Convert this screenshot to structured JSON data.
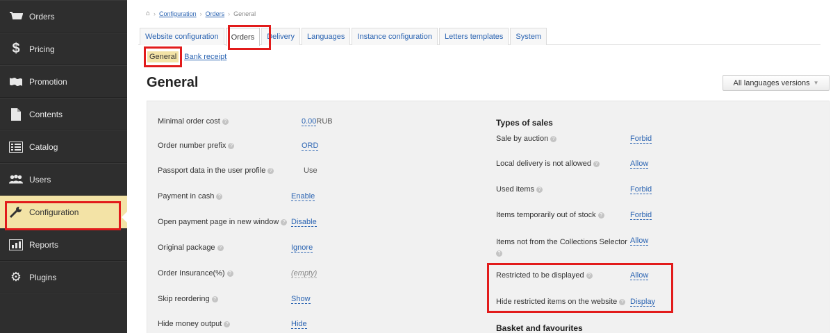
{
  "sidebar": {
    "items": [
      {
        "label": "Orders",
        "icon": "cart-icon"
      },
      {
        "label": "Pricing",
        "icon": "dollar-icon"
      },
      {
        "label": "Promotion",
        "icon": "flag-icon"
      },
      {
        "label": "Contents",
        "icon": "document-icon"
      },
      {
        "label": "Catalog",
        "icon": "list-icon"
      },
      {
        "label": "Users",
        "icon": "users-icon"
      },
      {
        "label": "Configuration",
        "icon": "wrench-icon",
        "active": true
      },
      {
        "label": "Reports",
        "icon": "bar-chart-icon"
      },
      {
        "label": "Plugins",
        "icon": "gear-icon"
      }
    ]
  },
  "breadcrumb": {
    "home_icon": "home-icon",
    "item1": "Configuration",
    "item2": "Orders",
    "current": "General"
  },
  "tabs": [
    {
      "label": "Website configuration"
    },
    {
      "label": "Orders",
      "active": true
    },
    {
      "label": "Delivery"
    },
    {
      "label": "Languages"
    },
    {
      "label": "Instance configuration"
    },
    {
      "label": "Letters templates"
    },
    {
      "label": "System"
    }
  ],
  "subtabs": {
    "active": "General",
    "other": "Bank receipt"
  },
  "page": {
    "title": "General",
    "lang_button": "All languages versions"
  },
  "left_settings": [
    {
      "label": "Minimal order cost",
      "value": "0.00",
      "suffix": " RUB",
      "kind": "link"
    },
    {
      "label": "Order number prefix",
      "value": "ORD",
      "kind": "link"
    },
    {
      "label": "Passport data in the user profile",
      "value": "Use",
      "kind": "text"
    },
    {
      "label": "Payment in cash",
      "value": "Enable",
      "kind": "link"
    },
    {
      "label": "Open payment page in new window",
      "value": "Disable",
      "kind": "link"
    },
    {
      "label": "Original package",
      "value": "Ignore",
      "kind": "link"
    },
    {
      "label": "Order Insurance(%)",
      "value": "(empty)",
      "kind": "empty"
    },
    {
      "label": "Skip reordering",
      "value": "Show",
      "kind": "link"
    },
    {
      "label": "Hide money output",
      "value": "Hide",
      "kind": "link"
    }
  ],
  "right": {
    "section1": "Types of sales",
    "settings": [
      {
        "label": "Sale by auction",
        "value": "Forbid"
      },
      {
        "label": "Local delivery is not allowed",
        "value": "Allow"
      },
      {
        "label": "Used items",
        "value": "Forbid"
      },
      {
        "label": "Items temporarily out of stock",
        "value": "Forbid"
      },
      {
        "label": "Items not from the Collections Selector",
        "value": "Allow"
      },
      {
        "label": "Restricted to be displayed",
        "value": "Allow"
      },
      {
        "label": "Hide restricted items on the website",
        "value": "Display"
      }
    ],
    "section2": "Basket and favourites"
  },
  "help_glyph": "?"
}
